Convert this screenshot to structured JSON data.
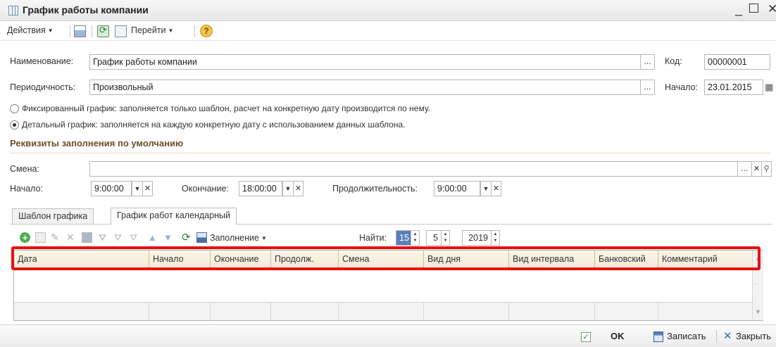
{
  "window": {
    "title": "График работы компании"
  },
  "toolbar": {
    "actions_label": "Действия",
    "goto_label": "Перейти",
    "help": "?"
  },
  "form": {
    "name_label": "Наименование:",
    "name_value": "График работы компании",
    "code_label": "Код:",
    "code_value": "00000001",
    "periodicity_label": "Периодичность:",
    "periodicity_value": "Произвольный",
    "start_label": "Начало:",
    "start_value": "23.01.2015",
    "dots": "...",
    "radio_fixed": "Фиксированный график: заполняется только шаблон, расчет на конкретную дату производится по нему.",
    "radio_detailed": "Детальный график: заполняется на каждую конкретную дату с использованием данных шаблона.",
    "selected_mode": "detailed"
  },
  "defaults": {
    "section_title": "Реквизиты заполнения по умолчанию",
    "shift_label": "Смена:",
    "shift_value": "",
    "begin_label": "Начало:",
    "begin_value": "9:00:00",
    "end_label": "Окончание:",
    "end_value": "18:00:00",
    "duration_label": "Продолжительность:",
    "duration_value": "9:00:00"
  },
  "tabs": [
    {
      "label": "Шаблон графика",
      "active": false
    },
    {
      "label": "График работ календарный",
      "active": true
    }
  ],
  "table_toolbar": {
    "fill_label": "Заполнение",
    "find_label": "Найти:",
    "day_value": "15",
    "month_value": "5",
    "year_value": "2019"
  },
  "grid": {
    "columns": [
      "Дата",
      "Начало",
      "Окончание",
      "Продолж.",
      "Смена",
      "Вид дня",
      "Вид интервала",
      "Банковский",
      "Комментарий"
    ],
    "rows": []
  },
  "statusbar": {
    "ok_label": "OK",
    "save_label": "Записать",
    "close_label": "Закрыть"
  },
  "colors": {
    "highlight": "#e81010",
    "section_title": "#6b4f2a",
    "grid_header": "#f2e9d8"
  }
}
